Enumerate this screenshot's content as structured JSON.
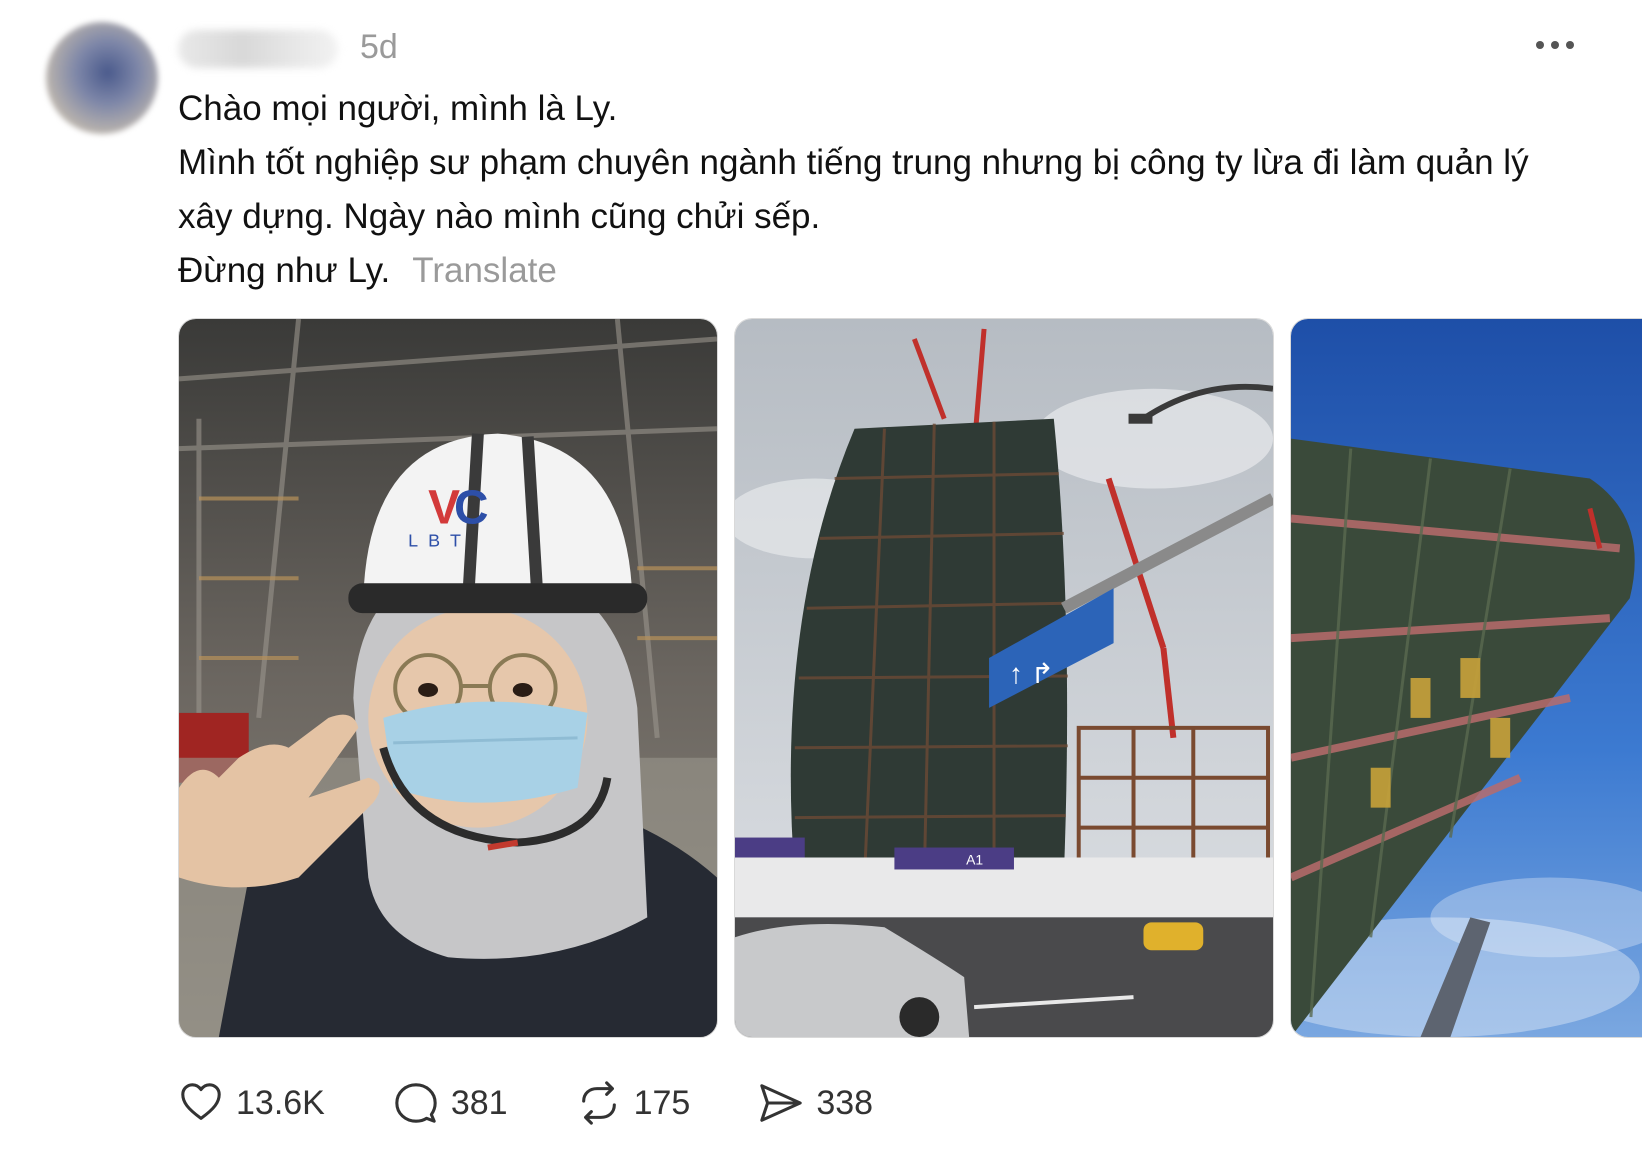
{
  "post": {
    "timestamp": "5d",
    "lines": [
      "Chào mọi người, mình là Ly.",
      "Mình tốt nghiệp sư phạm chuyên ngành tiếng trung nhưng bị công ty lừa đi làm quản lý xây dựng. Ngày nào mình cũng chửi sếp.",
      "Đừng như Ly."
    ],
    "translate_label": "Translate"
  },
  "photo_text": {
    "helmet_logo": "LBT",
    "station_sign": "A1"
  },
  "actions": {
    "likes": "13.6K",
    "replies": "381",
    "reposts": "175",
    "shares": "338"
  },
  "icons": {
    "more": "more-horizontal-icon",
    "like": "heart-icon",
    "reply": "comment-bubble-icon",
    "repost": "repost-arrows-icon",
    "share": "send-paper-plane-icon"
  },
  "colors": {
    "text": "#101010",
    "muted": "#9a9a9a",
    "icon": "#333333"
  }
}
